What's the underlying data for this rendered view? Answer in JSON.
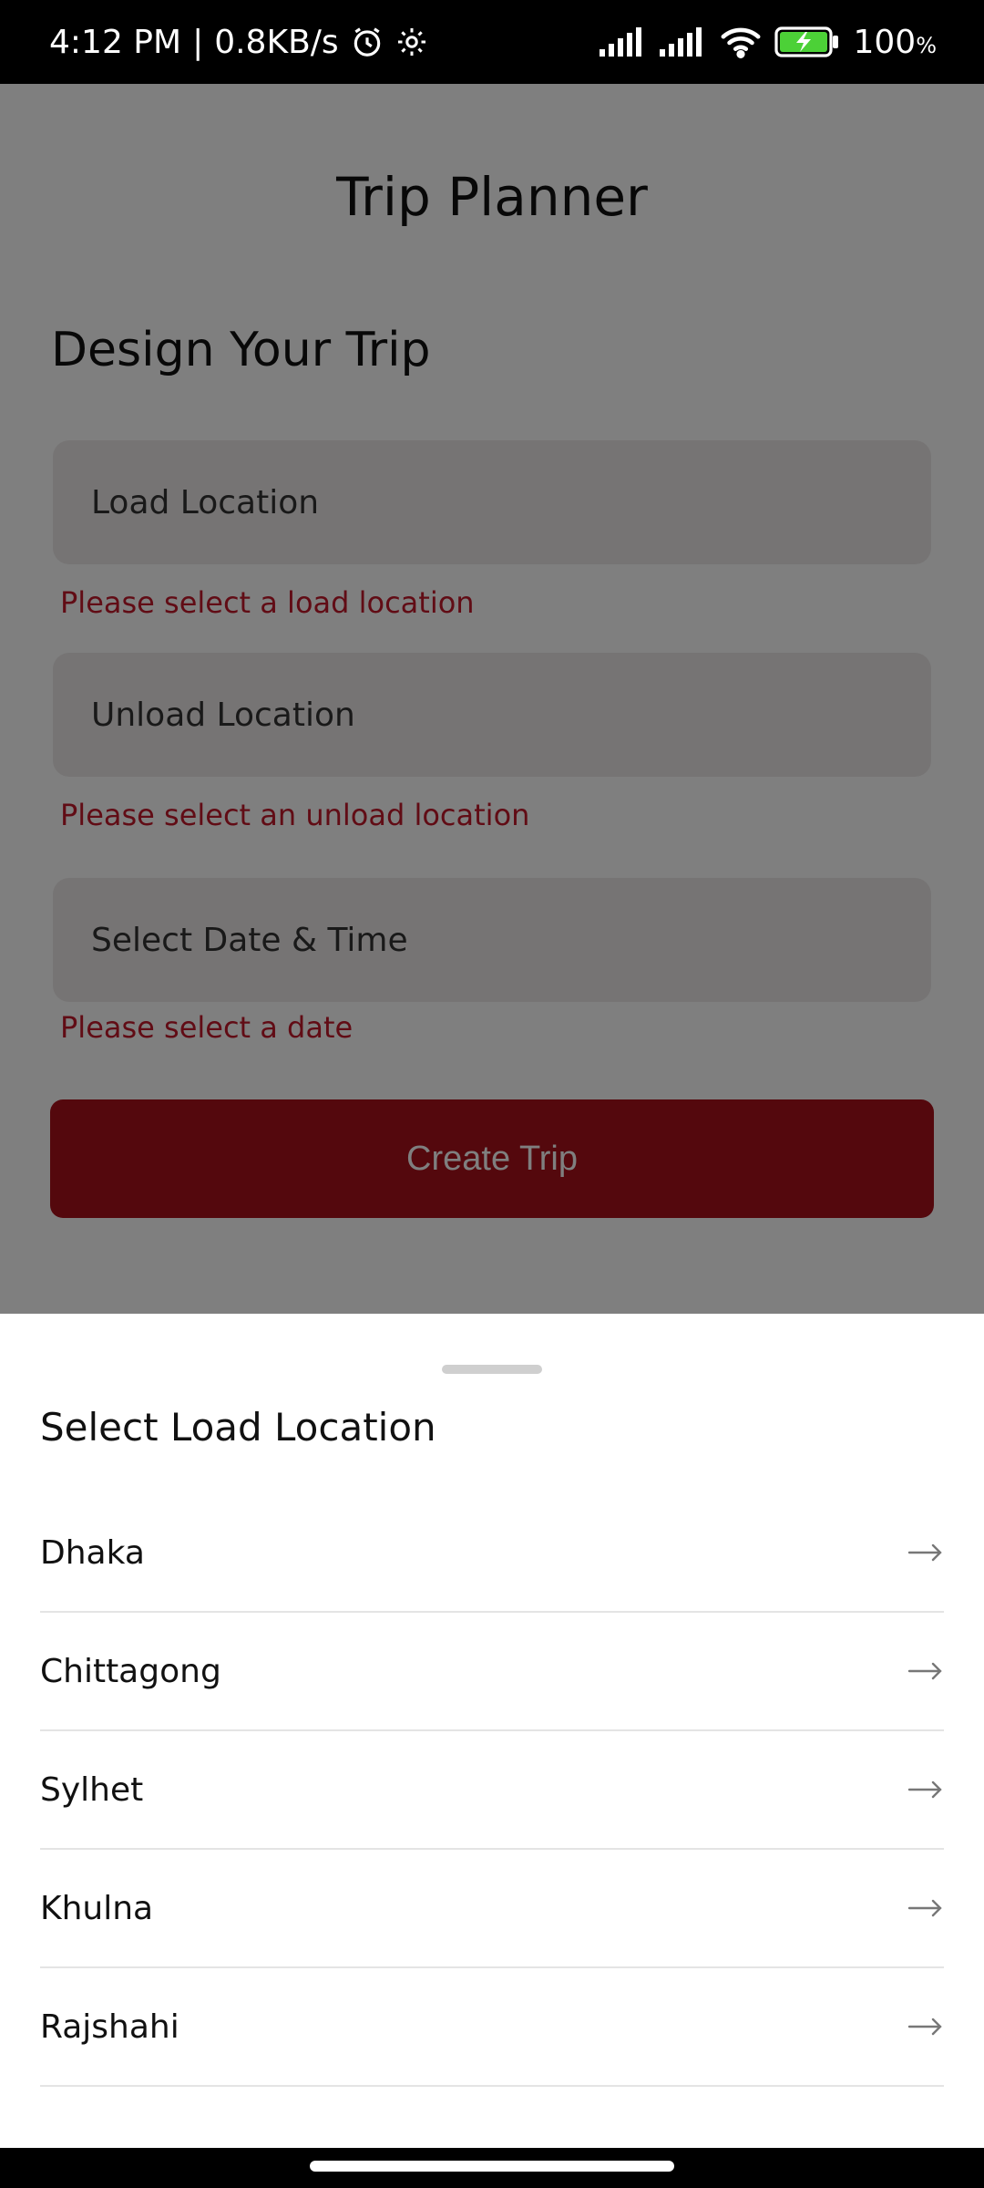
{
  "status_bar": {
    "time": "4:12 PM",
    "separator": "|",
    "net_speed": "0.8KB/s",
    "battery": "100",
    "battery_unit": "%",
    "icons": [
      "alarm-icon",
      "settings-icon",
      "signal-icon",
      "signal-icon",
      "wifi-icon",
      "battery-charging-icon"
    ]
  },
  "header": {
    "title": "Trip Planner"
  },
  "form": {
    "section_title": "Design Your Trip",
    "load_location": {
      "placeholder": "Load Location",
      "error": "Please select a load location"
    },
    "unload_location": {
      "placeholder": "Unload Location",
      "error": "Please select an unload location"
    },
    "date_time": {
      "placeholder": "Select Date & Time",
      "error": "Please select a date"
    },
    "submit_label": "Create Trip"
  },
  "sheet": {
    "title": "Select Load Location",
    "locations": [
      "Dhaka",
      "Chittagong",
      "Sylhet",
      "Khulna",
      "Rajshahi"
    ]
  },
  "colors": {
    "accent": "#a8101b",
    "error": "#c2182b",
    "field_bg": "#ece9e9"
  }
}
